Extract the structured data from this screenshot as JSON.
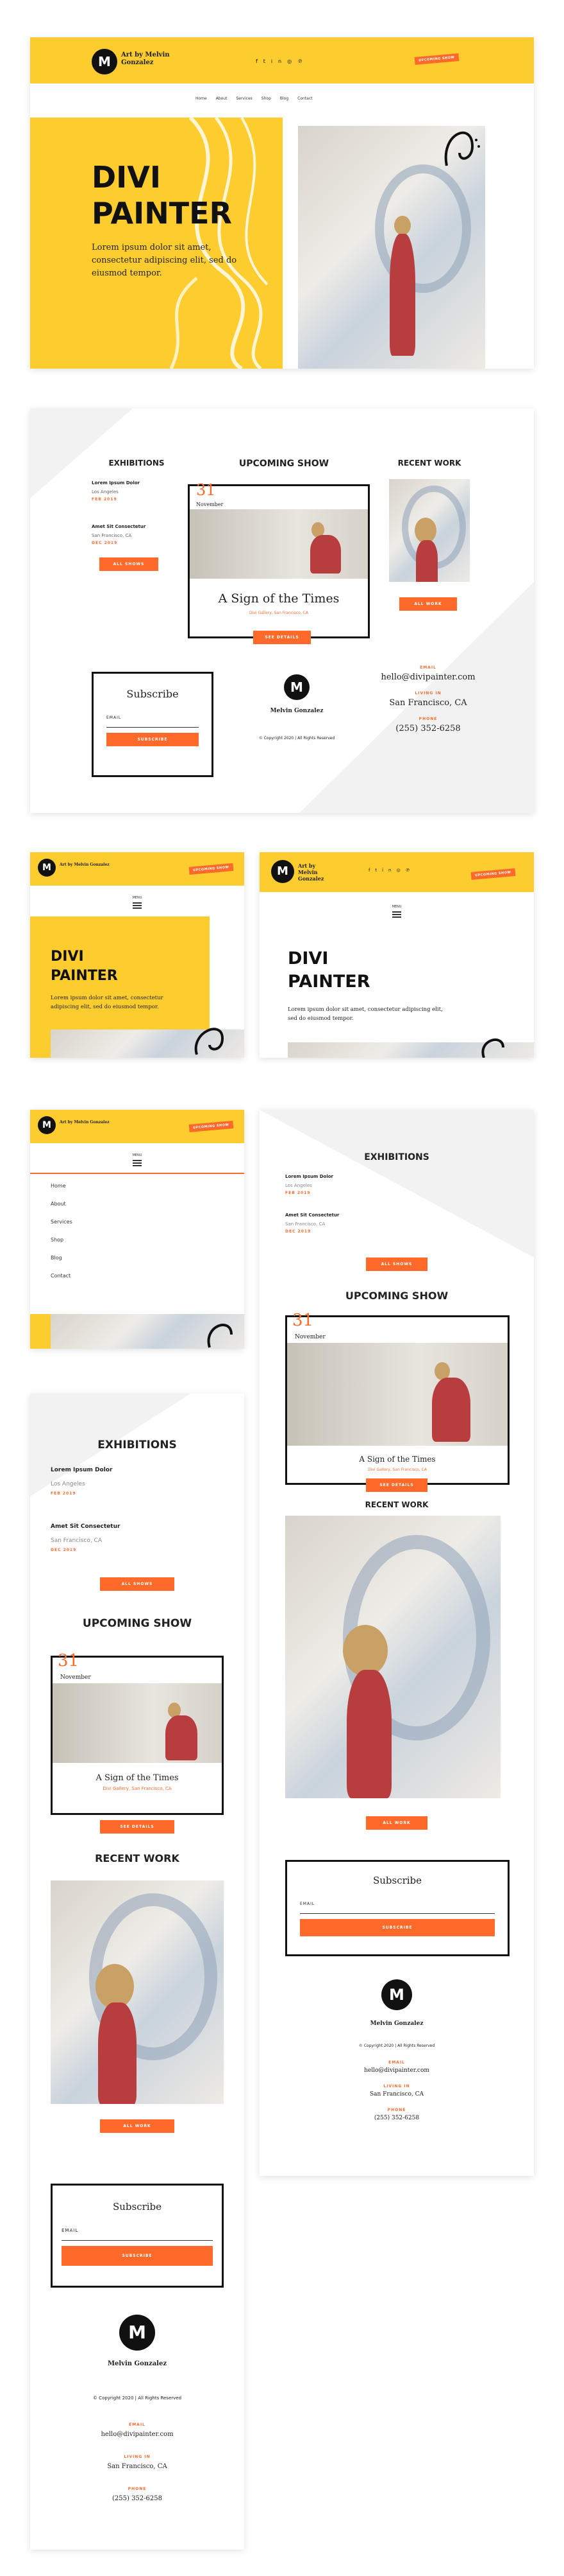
{
  "brand": {
    "name": "Art by Melvin Gonzalez",
    "logo_letter": "M",
    "upcoming_tag": "UPCOMING SHOW"
  },
  "nav": [
    "Home",
    "About",
    "Services",
    "Shop",
    "Blog",
    "Contact"
  ],
  "menu_label": "MENU",
  "social_icons": [
    "facebook-icon",
    "twitter-icon",
    "linkedin-icon",
    "instagram-icon",
    "pinterest-icon"
  ],
  "hero": {
    "title_line1": "DIVI",
    "title_line2": "PAINTER",
    "text": "Lorem ipsum dolor sit amet, consectetur adipiscing elit, sed do eiusmod tempor.",
    "text_short": "Lorem ipsum dolor sit amet, consectetur adipiscing elit, sed do eiusmod tempor."
  },
  "exhibitions": {
    "title": "EXHIBITIONS",
    "items": [
      {
        "name": "Lorem Ipsum Dolor",
        "place": "Los Angeles",
        "date": "FEB 2019"
      },
      {
        "name": "Amet Sit Consectetur",
        "place": "San Francisco, CA",
        "date": "DEC 2019"
      }
    ],
    "button": "ALL SHOWS"
  },
  "upcoming": {
    "title": "UPCOMING SHOW",
    "day": "31",
    "month": "November",
    "show_name": "A Sign of the Times",
    "venue": "Divi Gallery, San Francisco, CA",
    "button": "SEE DETAILS"
  },
  "recent": {
    "title": "RECENT WORK",
    "button": "ALL WORK"
  },
  "subscribe": {
    "title": "Subscribe",
    "email_label": "EMAIL",
    "button": "SUBSCRIBE"
  },
  "footer": {
    "name": "Melvin Gonzalez",
    "copyright": "© Copyright 2020 | All Rights Reserved"
  },
  "contact": {
    "email_label": "EMAIL",
    "email": "hello@divipainter.com",
    "living_label": "LIVING IN",
    "living": "San Francisco, CA",
    "phone_label": "PHONE",
    "phone": "(255) 352-6258"
  },
  "colors": {
    "yellow": "#fdcc2e",
    "orange": "#ff6a2b",
    "dark": "#111111"
  }
}
